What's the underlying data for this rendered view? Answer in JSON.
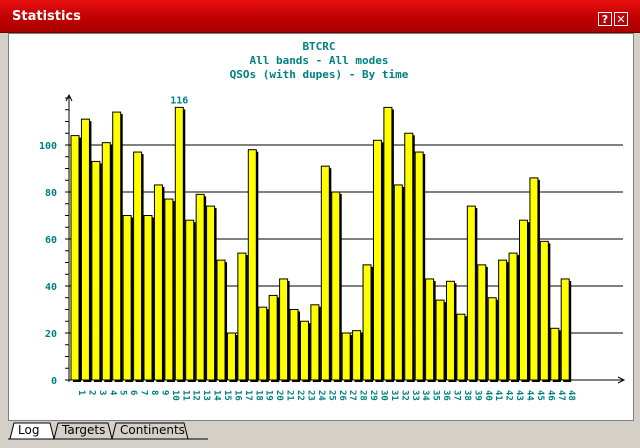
{
  "window": {
    "title": "Statistics",
    "help_label": "?",
    "close_label": "✕"
  },
  "tabs": [
    {
      "label": "Log"
    },
    {
      "label": "Targets"
    },
    {
      "label": "Continents"
    }
  ],
  "chart_data": {
    "type": "bar",
    "title": "BTCRC",
    "subtitle": "All bands - All modes",
    "subtitle2": "QSOs (with dupes) - By time",
    "ylim": [
      0,
      120
    ],
    "yticks": [
      0,
      20,
      40,
      60,
      80,
      100
    ],
    "grid": true,
    "bar_color": "#ffff00",
    "max_label": "116",
    "categories": [
      "1",
      "2",
      "3",
      "4",
      "5",
      "6",
      "7",
      "8",
      "9",
      "10",
      "11",
      "12",
      "13",
      "14",
      "15",
      "16",
      "17",
      "18",
      "19",
      "20",
      "21",
      "22",
      "23",
      "24",
      "25",
      "26",
      "27",
      "28",
      "29",
      "30",
      "31",
      "32",
      "33",
      "34",
      "35",
      "36",
      "37",
      "38",
      "39",
      "40",
      "41",
      "42",
      "43",
      "44",
      "45",
      "46",
      "47",
      "48"
    ],
    "values": [
      104,
      111,
      93,
      101,
      114,
      70,
      97,
      70,
      83,
      77,
      116,
      68,
      79,
      74,
      51,
      20,
      54,
      98,
      31,
      36,
      43,
      30,
      25,
      32,
      91,
      80,
      20,
      21,
      49,
      102,
      116,
      83,
      105,
      97,
      43,
      34,
      42,
      28,
      74,
      49,
      35,
      51,
      54,
      68,
      86,
      59,
      22,
      43
    ]
  }
}
